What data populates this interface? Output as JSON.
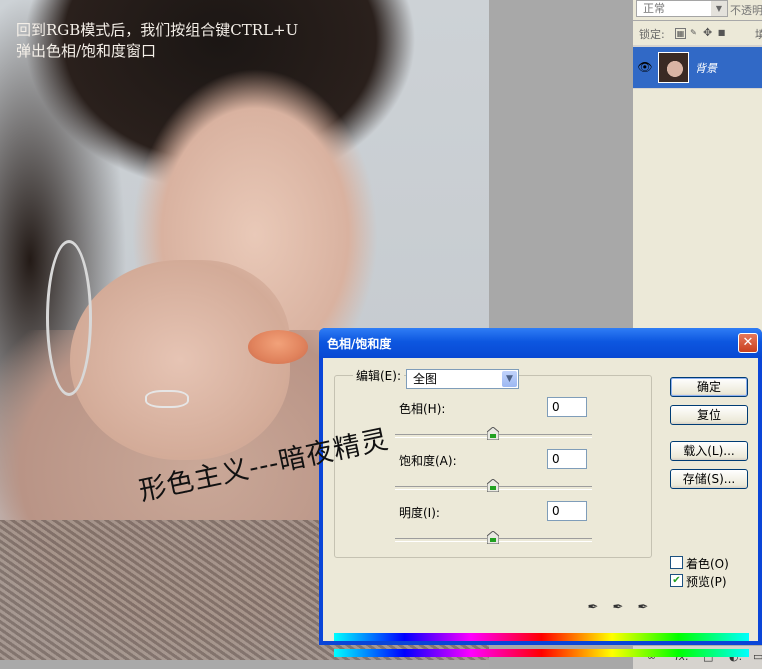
{
  "canvas": {
    "caption_line1": "回到RGB模式后，我们按组合键CTRL+U",
    "caption_line2": "弹出色相/饱和度窗口",
    "watermark": "形色主义---暗夜精灵"
  },
  "layers_panel": {
    "blend_mode": "正常",
    "opacity_label": "不透明",
    "lock_label": "锁定:",
    "fill_label": "填",
    "layer": {
      "name": "背景",
      "visible": true
    },
    "bottom_icons": [
      "link-icon",
      "fx-icon",
      "mask-icon",
      "adjustment-icon",
      "folder-icon"
    ],
    "bottom_labels": [
      "∞",
      "fx.",
      "□",
      "◐.",
      "▭"
    ]
  },
  "dialog": {
    "title": "色相/饱和度",
    "edit_label": "编辑(E):",
    "edit_value": "全图",
    "hue_label": "色相(H):",
    "hue_value": "0",
    "saturation_label": "饱和度(A):",
    "saturation_value": "0",
    "lightness_label": "明度(I):",
    "lightness_value": "0",
    "ok_button": "确定",
    "reset_button": "复位",
    "load_button": "载入(L)...",
    "save_button": "存储(S)...",
    "colorize_label": "着色(O)",
    "colorize_checked": false,
    "preview_label": "预览(P)",
    "preview_checked": true,
    "close_glyph": "✕"
  },
  "colors": {
    "title_bar": "#0d57e0",
    "dialog_bg": "#ece9d8",
    "layer_selected": "#3169c6"
  }
}
